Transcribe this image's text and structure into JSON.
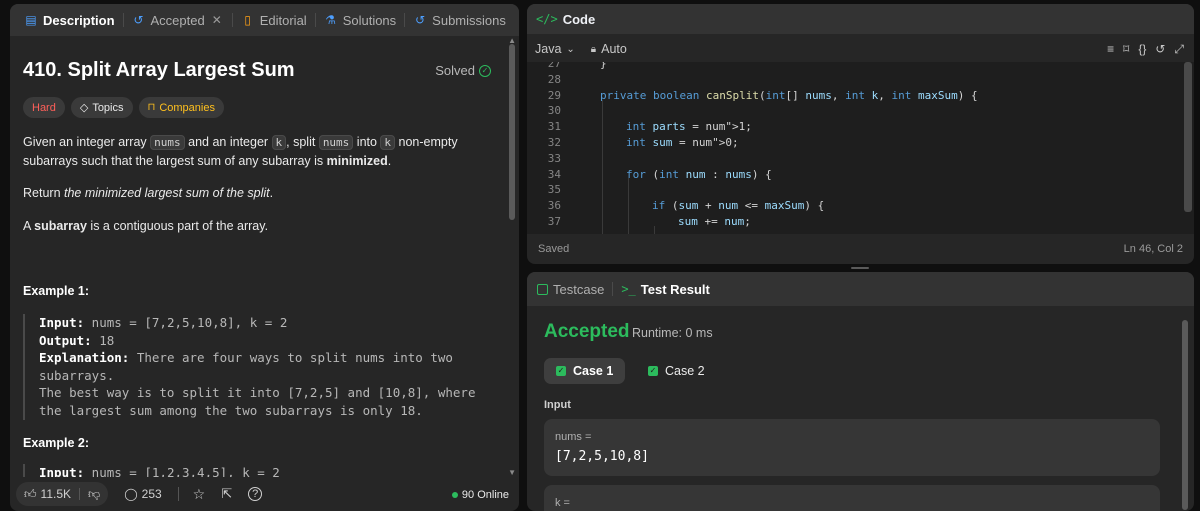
{
  "left_tabs": {
    "description": "Description",
    "accepted": "Accepted",
    "editorial": "Editorial",
    "solutions": "Solutions",
    "submissions": "Submissions"
  },
  "problem": {
    "title": "410. Split Array Largest Sum",
    "status": "Solved",
    "difficulty": "Hard",
    "topics": "Topics",
    "companies": "Companies"
  },
  "description": {
    "p1_a": "Given an integer array ",
    "p1_code1": "nums",
    "p1_b": " and an integer ",
    "p1_code2": "k",
    "p1_c": ", split ",
    "p1_code3": "nums",
    "p1_d": " into ",
    "p1_code4": "k",
    "p1_e": " non-empty",
    "p1_f": "subarrays such that the largest sum of any subarray is ",
    "p1_bold": "minimized",
    "p1_end": ".",
    "p2_a": "Return ",
    "p2_em": "the minimized largest sum of the split",
    "p2_end": ".",
    "p3_a": "A ",
    "p3_bold": "subarray",
    "p3_b": " is a contiguous part of the array."
  },
  "example1": {
    "heading": "Example 1:",
    "input_label": "Input:",
    "input_value": " nums = [7,2,5,10,8], k = 2",
    "output_label": "Output:",
    "output_value": " 18",
    "expl_label": "Explanation:",
    "expl_line1": " There are four ways to split nums into two",
    "expl_line2": "subarrays.",
    "expl_line3": "The best way is to split it into [7,2,5] and [10,8], where",
    "expl_line4": "the largest sum among the two subarrays is only 18."
  },
  "example2": {
    "heading": "Example 2:",
    "input_label": "Input:",
    "input_value": " nums = [1,2,3,4,5], k = 2"
  },
  "footer": {
    "likes": "11.5K",
    "comments": "253",
    "online": "90 Online"
  },
  "code_panel": {
    "tab": "Code",
    "language": "Java",
    "mode": "Auto",
    "saved": "Saved",
    "cursor": "Ln 46, Col 2",
    "lines": [
      {
        "n": "27",
        "text": "}"
      },
      {
        "n": "28",
        "text": ""
      },
      {
        "n": "29",
        "text": "private boolean canSplit(int[] nums, int k, int maxSum) {"
      },
      {
        "n": "30",
        "text": ""
      },
      {
        "n": "31",
        "text": "int parts = 1;"
      },
      {
        "n": "32",
        "text": "int sum = 0;"
      },
      {
        "n": "33",
        "text": ""
      },
      {
        "n": "34",
        "text": "for (int num : nums) {"
      },
      {
        "n": "35",
        "text": ""
      },
      {
        "n": "36",
        "text": "if (sum + num <= maxSum) {"
      },
      {
        "n": "37",
        "text": "sum += num;"
      }
    ]
  },
  "result_panel": {
    "testcase_tab": "Testcase",
    "result_tab": "Test Result",
    "verdict": "Accepted",
    "runtime": "Runtime: 0 ms",
    "case1": "Case 1",
    "case2": "Case 2",
    "input_label": "Input",
    "field1_name": "nums =",
    "field1_value": "[7,2,5,10,8]",
    "field2_name": "k ="
  },
  "colors": {
    "accent_green": "#2cbb5d",
    "hard_red": "#ff5f59",
    "companies_yellow": "#ffc01e"
  }
}
